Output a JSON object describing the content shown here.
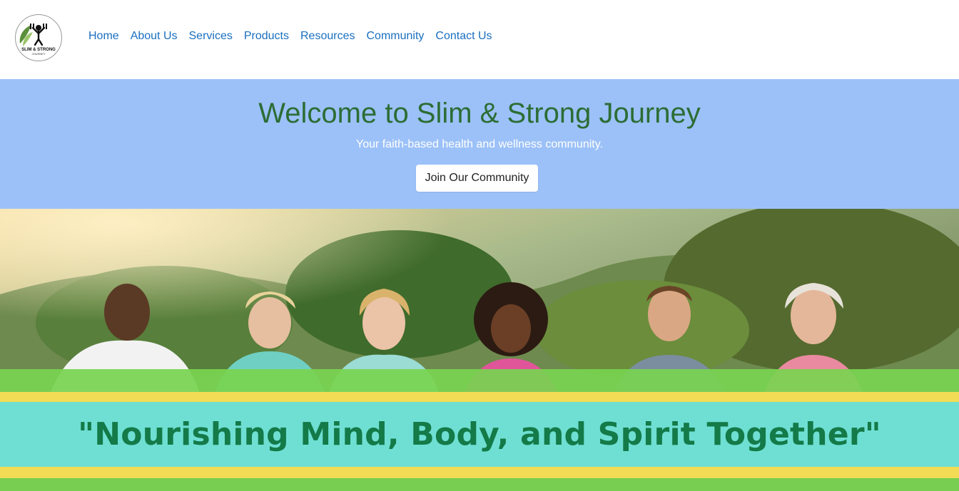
{
  "header": {
    "logo": {
      "line1": "SLIM & STRONG",
      "line2": "JOURNEY"
    },
    "nav": [
      "Home",
      "About Us",
      "Services",
      "Products",
      "Resources",
      "Community",
      "Contact Us"
    ]
  },
  "hero": {
    "title": "Welcome to Slim & Strong Journey",
    "subtitle": "Your faith-based health and wellness community.",
    "cta_label": "Join Our Community"
  },
  "banner": {
    "quote": "\"Nourishing Mind, Body, and Spirit Together\""
  },
  "colors": {
    "hero_bg": "#9cc1f8",
    "hero_title": "#2c6d35",
    "nav_link": "#1a6fc0",
    "quote_text": "#137a48",
    "band_teal": "#6fdfd3",
    "band_yellow": "#f2dc55",
    "band_green": "#78d450"
  }
}
